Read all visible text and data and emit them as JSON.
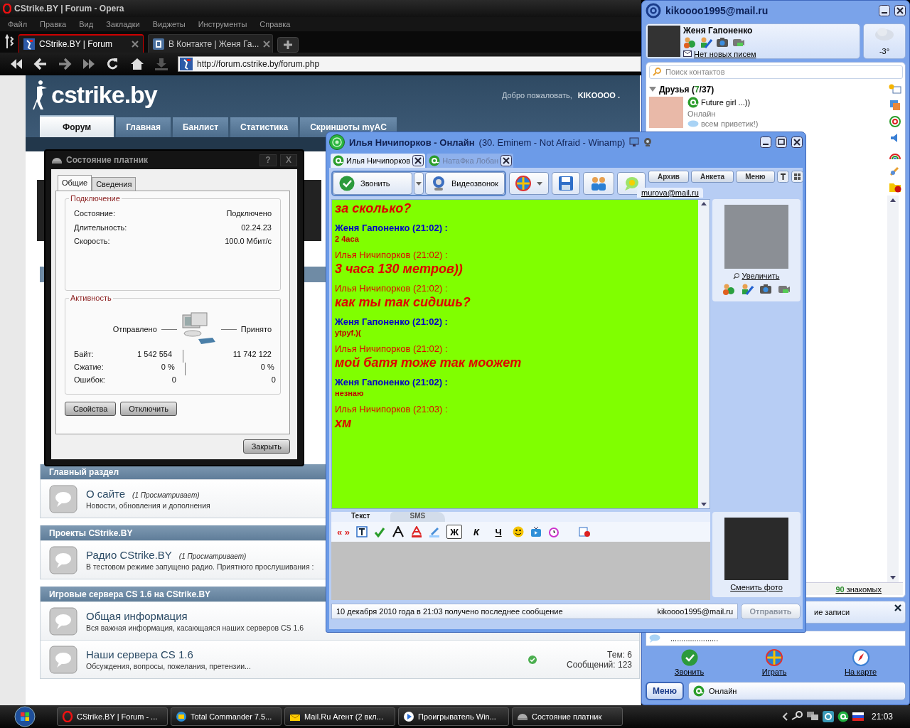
{
  "opera": {
    "title": "CStrike.BY | Forum - Opera",
    "menu": [
      "Файл",
      "Правка",
      "Вид",
      "Закладки",
      "Виджеты",
      "Инструменты",
      "Справка"
    ],
    "tabs": [
      {
        "label": "CStrike.BY | Forum",
        "selected": true
      },
      {
        "label": "В Контакте | Женя Га...",
        "selected": false
      }
    ],
    "address": "http://forum.cstrike.by/forum.php"
  },
  "forum": {
    "logo": "cstrike.by",
    "welcome": "Добро пожаловать,",
    "user": "KIKOOOO .",
    "nav": [
      {
        "label": "Форум",
        "selected": true
      },
      {
        "label": "Главная",
        "selected": false
      },
      {
        "label": "Банлист",
        "selected": false
      },
      {
        "label": "Статистика",
        "selected": false
      },
      {
        "label": "Скриншоты myAC",
        "selected": false
      }
    ],
    "sections": [
      {
        "title": "Главный раздел",
        "forums": [
          {
            "name": "О сайте",
            "viewers": "(1 Просматривает)",
            "description": "Новости, обновления и дополнения"
          }
        ]
      },
      {
        "title": "Проекты CStrike.BY",
        "forums": [
          {
            "name": "Радио CStrike.BY",
            "viewers": "(1 Просматривает)",
            "description": "В тестовом режиме запущено радио. Приятного прослушивания :"
          }
        ]
      },
      {
        "title": "Игровые сервера CS 1.6 на CStrike.BY",
        "forums": [
          {
            "name": "Общая информация",
            "description": "Вся важная информация, касающаяся наших серверов CS 1.6"
          },
          {
            "name": "Наши сервера CS 1.6",
            "description": "Обсуждения, вопросы, пожелания, претензии...",
            "topics": "Тем: 6",
            "posts": "Сообщений: 123"
          }
        ]
      }
    ]
  },
  "status_dialog": {
    "title": "Состояние платник",
    "title_buttons": [
      "?",
      "X"
    ],
    "tabs": [
      {
        "label": "Общие",
        "selected": true
      },
      {
        "label": "Сведения",
        "selected": false
      }
    ],
    "connection": {
      "legend": "Подключение",
      "rows": [
        {
          "label": "Состояние:",
          "value": "Подключено"
        },
        {
          "label": "Длительность:",
          "value": "02.24.23"
        },
        {
          "label": "Скорость:",
          "value": "100.0 Мбит/с"
        }
      ]
    },
    "activity": {
      "legend": "Активность",
      "sent": "Отправлено",
      "received": "Принято",
      "rows": [
        {
          "label": "Байт:",
          "sent": "1 542 554",
          "received": "11 742 122"
        },
        {
          "label": "Сжатие:",
          "sent": "0 %",
          "received": "0 %"
        },
        {
          "label": "Ошибок:",
          "sent": "0",
          "received": "0"
        }
      ]
    },
    "buttons": [
      "Свойства",
      "Отключить"
    ],
    "close": "Закрыть"
  },
  "chat_window": {
    "title": "Илья Ничипорков - Онлайн",
    "subtitle": "(30. Eminem - Not Afraid - Winamp)",
    "tabs": [
      {
        "label": "Илья Ничипорков",
        "selected": true
      },
      {
        "label": "НатаФка Лобан",
        "selected": false
      }
    ],
    "call": "Звонить",
    "video": "Видеозвонок",
    "side_buttons": [
      "Архив",
      "Анкета",
      "Меню"
    ],
    "contact_email": "murova@mail.ru",
    "messages": [
      {
        "kind": "other",
        "text": "за сколько?"
      },
      {
        "kind": "self",
        "header": "Женя Гапоненко (21:02) :",
        "text": "2 4аса"
      },
      {
        "kind": "other",
        "header": "Илья Ничипорков (21:02) :",
        "text": "3 часа 130 метров))"
      },
      {
        "kind": "other",
        "header": "Илья Ничипорков (21:02) :",
        "text": "как ты так сидишь?"
      },
      {
        "kind": "self",
        "header": "Женя Гапоненко (21:02) :",
        "text": "ytpyf.)("
      },
      {
        "kind": "other",
        "header": "Илья Ничипорков (21:02) :",
        "text": "мой батя тоже так моожет"
      },
      {
        "kind": "self",
        "header": "Женя Гапоненко (21:02) :",
        "text": "незнаю"
      },
      {
        "kind": "other",
        "header": "Илья Ничипорков (21:03) :",
        "text": "хм"
      }
    ],
    "zoom_link": "Увеличить",
    "input_tabs": [
      {
        "label": "Текст",
        "selected": true
      },
      {
        "label": "SMS",
        "selected": false
      }
    ],
    "quote": "« »",
    "format": [
      {
        "kind": "bold",
        "label": "Ж",
        "on": true
      },
      {
        "kind": "italic",
        "label": "К",
        "on": false
      },
      {
        "kind": "underline",
        "label": "Ч",
        "on": false
      }
    ],
    "change_photo": "Сменить фото",
    "status": "10 декабря 2010 года в 21:03 получено последнее сообщение",
    "account": "kikoooo1995@mail.ru",
    "send": {
      "label": "Отправить",
      "disabled": true
    }
  },
  "agent": {
    "title": "kikoooo1995@mail.ru",
    "user": "Женя Гапоненко",
    "mail": "Нет новых писем",
    "weather": "-3°",
    "search_placeholder": "Поиск контактов",
    "group": {
      "name": "Друзья",
      "count_open": "(",
      "online": "7",
      "count_close": "/37)",
      "expanded": true
    },
    "contacts": [
      {
        "name": "Future girl ...))",
        "status": "Онлайн",
        "message": "всем приветик!)"
      }
    ],
    "acquaintances_count": "90",
    "acquaintances": "знакомых",
    "notice": "ие записи",
    "status_message": "......................",
    "actions": [
      {
        "kind": "call",
        "label": "Звонить"
      },
      {
        "kind": "play",
        "label": "Играть"
      },
      {
        "kind": "map",
        "label": "На карте"
      }
    ],
    "menu": "Меню",
    "presence": "Онлайн"
  },
  "taskbar": {
    "items": [
      "CStrike.BY | Forum - ...",
      "Total Commander 7.5...",
      "Mail.Ru Агент (2 вкл...",
      "Проигрыватель Win...",
      "Состояние платник"
    ],
    "clock": "21:03"
  }
}
